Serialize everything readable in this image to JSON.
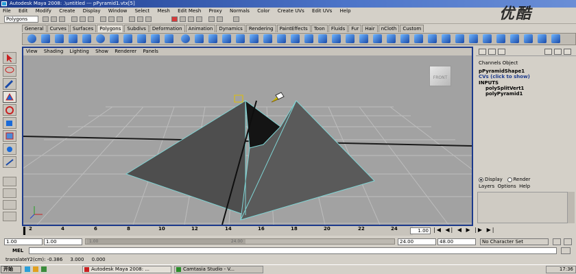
{
  "window": {
    "title": "Autodesk Maya 2008: .\\untitled  ---  pPyramid1.vtx[5]"
  },
  "menu": [
    "File",
    "Edit",
    "Modify",
    "Create",
    "Display",
    "Window",
    "Select",
    "Mesh",
    "Edit Mesh",
    "Proxy",
    "Normals",
    "Color",
    "Create UVs",
    "Edit UVs",
    "Help"
  ],
  "status_line": {
    "mode": "Polygons"
  },
  "shelf_tabs": [
    "General",
    "Curves",
    "Surfaces",
    "Polygons",
    "Subdivs",
    "Deformation",
    "Animation",
    "Dynamics",
    "Rendering",
    "PaintEffects",
    "Toon",
    "Fluids",
    "Fur",
    "Hair",
    "nCloth",
    "Custom"
  ],
  "shelf_active": "Polygons",
  "viewport": {
    "menu": [
      "View",
      "Shading",
      "Lighting",
      "Show",
      "Renderer",
      "Panels"
    ],
    "view_cube_label": "FRONT",
    "grid_color": "#c8c8c8",
    "face_color": "#4e4e4e",
    "edge_color": "#7fd4d4"
  },
  "channel_box": {
    "tabs": [
      "Channels",
      "Object"
    ],
    "object_name": "pPyramidShape1",
    "cv_row": "CVs (click to show)",
    "inputs_label": "INPUTS",
    "inputs": [
      "polySplitVert1",
      "polyPyramid1"
    ]
  },
  "layer_editor": {
    "display_label": "Display",
    "render_label": "Render",
    "menu": [
      "Layers",
      "Options",
      "Help"
    ]
  },
  "time_slider": {
    "ticks": [
      "2",
      "4",
      "6",
      "8",
      "10",
      "12",
      "14",
      "16",
      "18",
      "20",
      "22",
      "24"
    ],
    "current_frame": "1.00"
  },
  "range_slider": {
    "start": "1.00",
    "playback_start": "1.00",
    "thumb_start": "1.00",
    "thumb_end": "24.00",
    "playback_end": "24.00",
    "end": "48.00",
    "character_set": "No Character Set"
  },
  "command_line": {
    "label": "MEL"
  },
  "help_line": {
    "text": "translateY2(cm): -0.386     3.000     0.000"
  },
  "taskbar": {
    "start": "开始",
    "tasks": [
      "Autodesk Maya 2008: ...",
      "Camtasia Studio - V..."
    ],
    "clock": "17:36"
  },
  "watermark": "优酷"
}
